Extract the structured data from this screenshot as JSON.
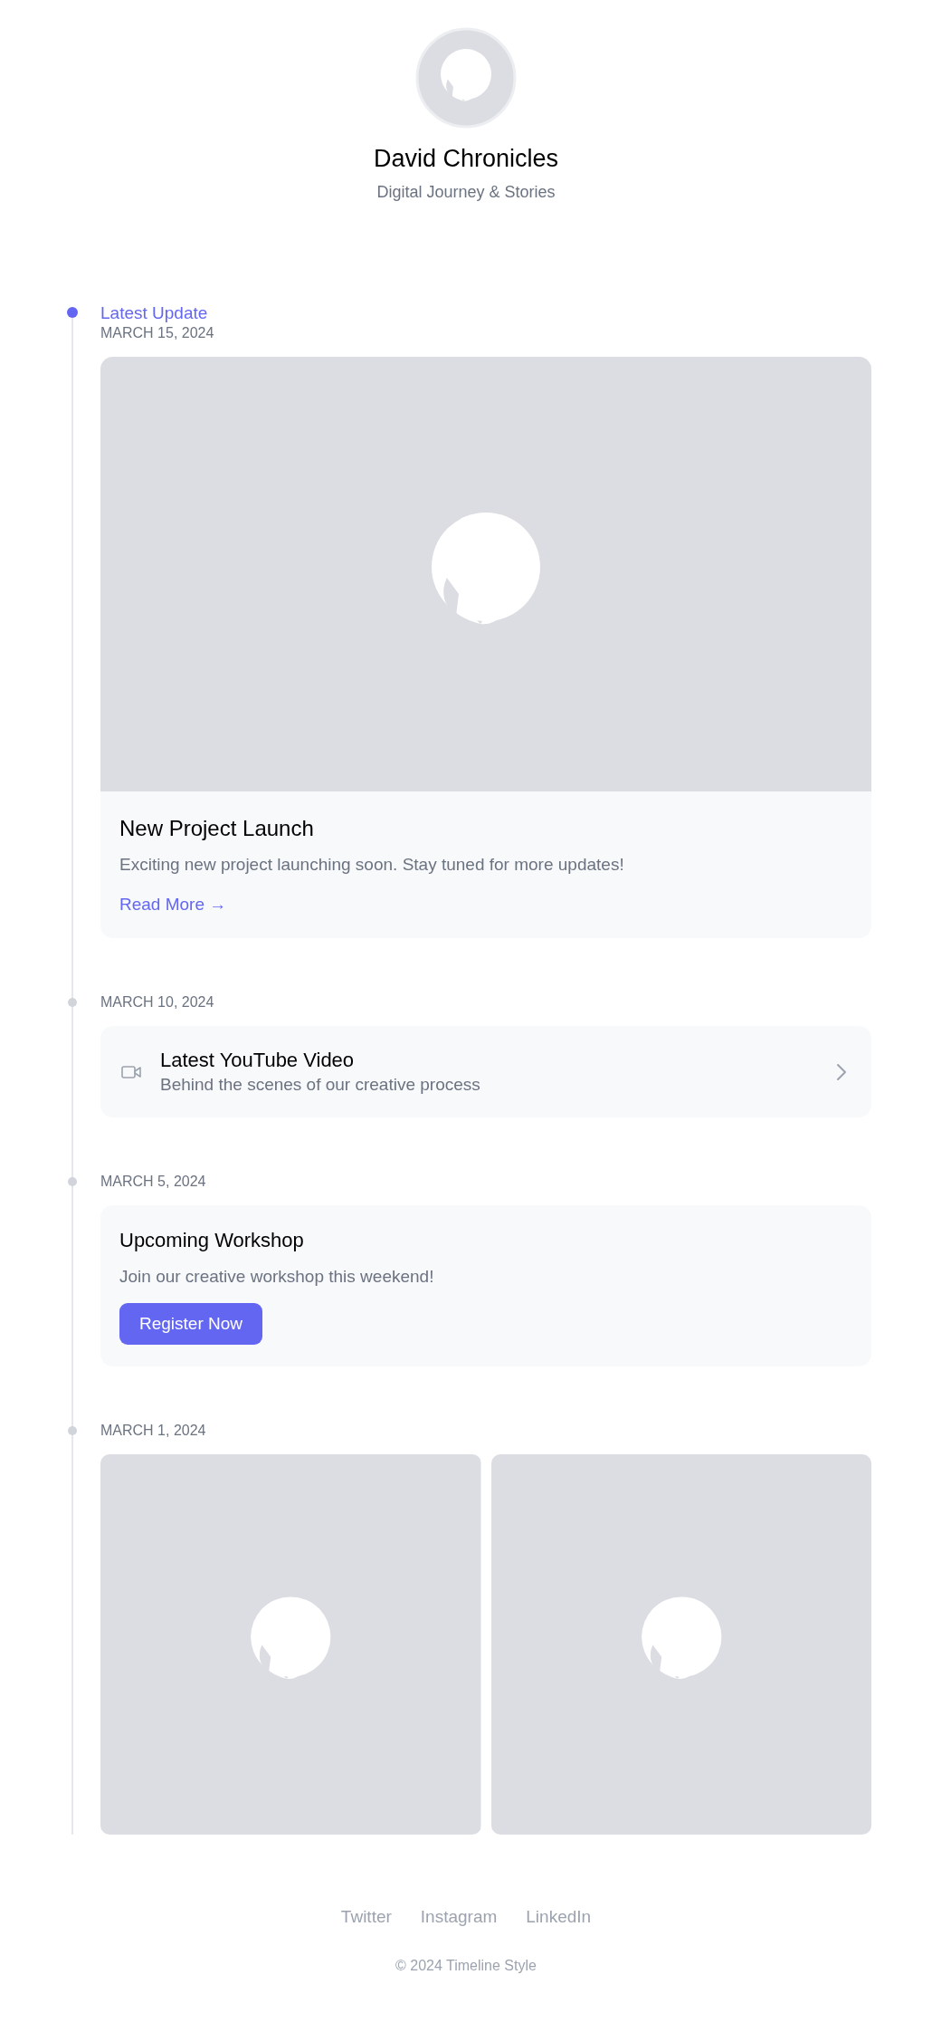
{
  "profile": {
    "name": "David Chronicles",
    "tagline": "Digital Journey & Stories"
  },
  "entries": [
    {
      "kind": "feature",
      "current": true,
      "label": "Latest Update",
      "date": "MARCH 15, 2024",
      "title": "New Project Launch",
      "text": "Exciting new project launching soon. Stay tuned for more updates!",
      "link": "Read More",
      "link_arrow": "→"
    },
    {
      "kind": "video",
      "current": false,
      "date": "MARCH 10, 2024",
      "title": "Latest YouTube Video",
      "text": "Behind the scenes of our creative process"
    },
    {
      "kind": "event",
      "current": false,
      "date": "MARCH 5, 2024",
      "title": "Upcoming Workshop",
      "text": "Join our creative workshop this weekend!",
      "button": "Register Now"
    },
    {
      "kind": "gallery",
      "current": false,
      "date": "MARCH 1, 2024"
    }
  ],
  "footer": {
    "links": [
      "Twitter",
      "Instagram",
      "LinkedIn"
    ],
    "copyright": "© 2024 Timeline Style"
  }
}
